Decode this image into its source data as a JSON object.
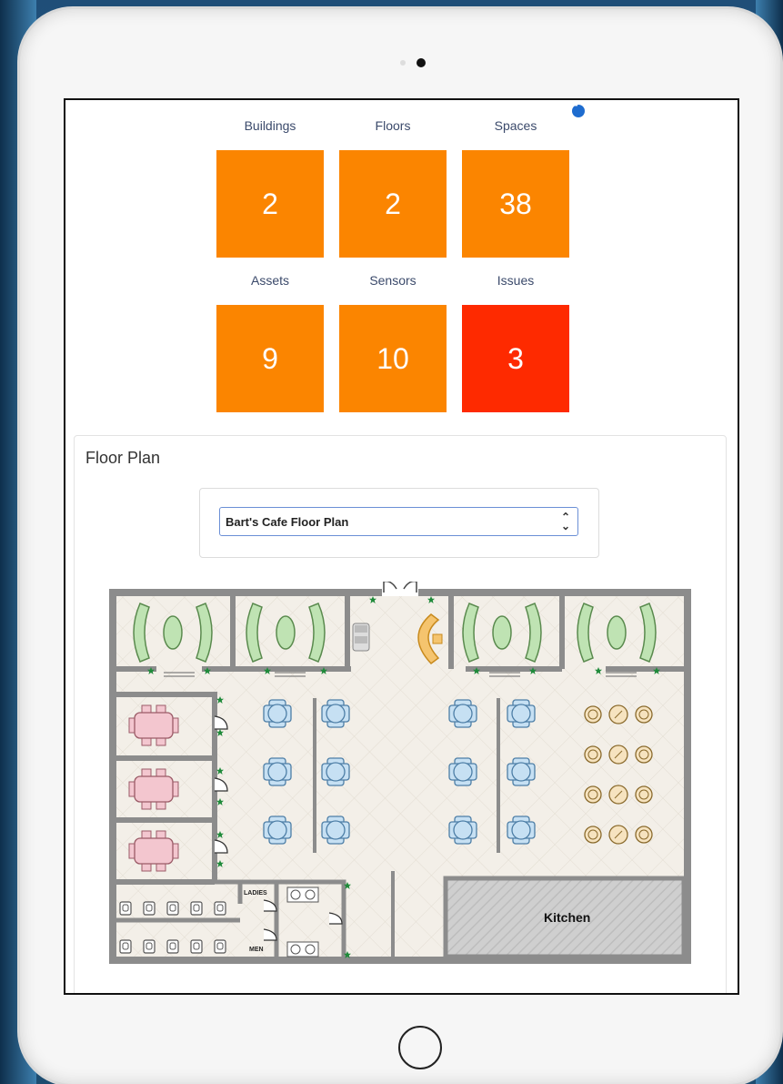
{
  "dashboard": {
    "tiles": [
      {
        "label": "Buildings",
        "value": "2",
        "color": "#fb8500"
      },
      {
        "label": "Floors",
        "value": "2",
        "color": "#fb8500"
      },
      {
        "label": "Spaces",
        "value": "38",
        "color": "#fb8500"
      },
      {
        "label": "Assets",
        "value": "9",
        "color": "#fb8500"
      },
      {
        "label": "Sensors",
        "value": "10",
        "color": "#fb8500"
      },
      {
        "label": "Issues",
        "value": "3",
        "color": "#fe2a00"
      }
    ]
  },
  "floor_plan": {
    "title": "Floor Plan",
    "selected_plan": "Bart's Cafe Floor Plan",
    "labels": {
      "ladies": "LADIES",
      "men": "MEN",
      "kitchen": "Kitchen"
    }
  },
  "icons": {
    "more": "more-dots-icon",
    "select": "chevron-updown-icon",
    "home": "home-button"
  }
}
